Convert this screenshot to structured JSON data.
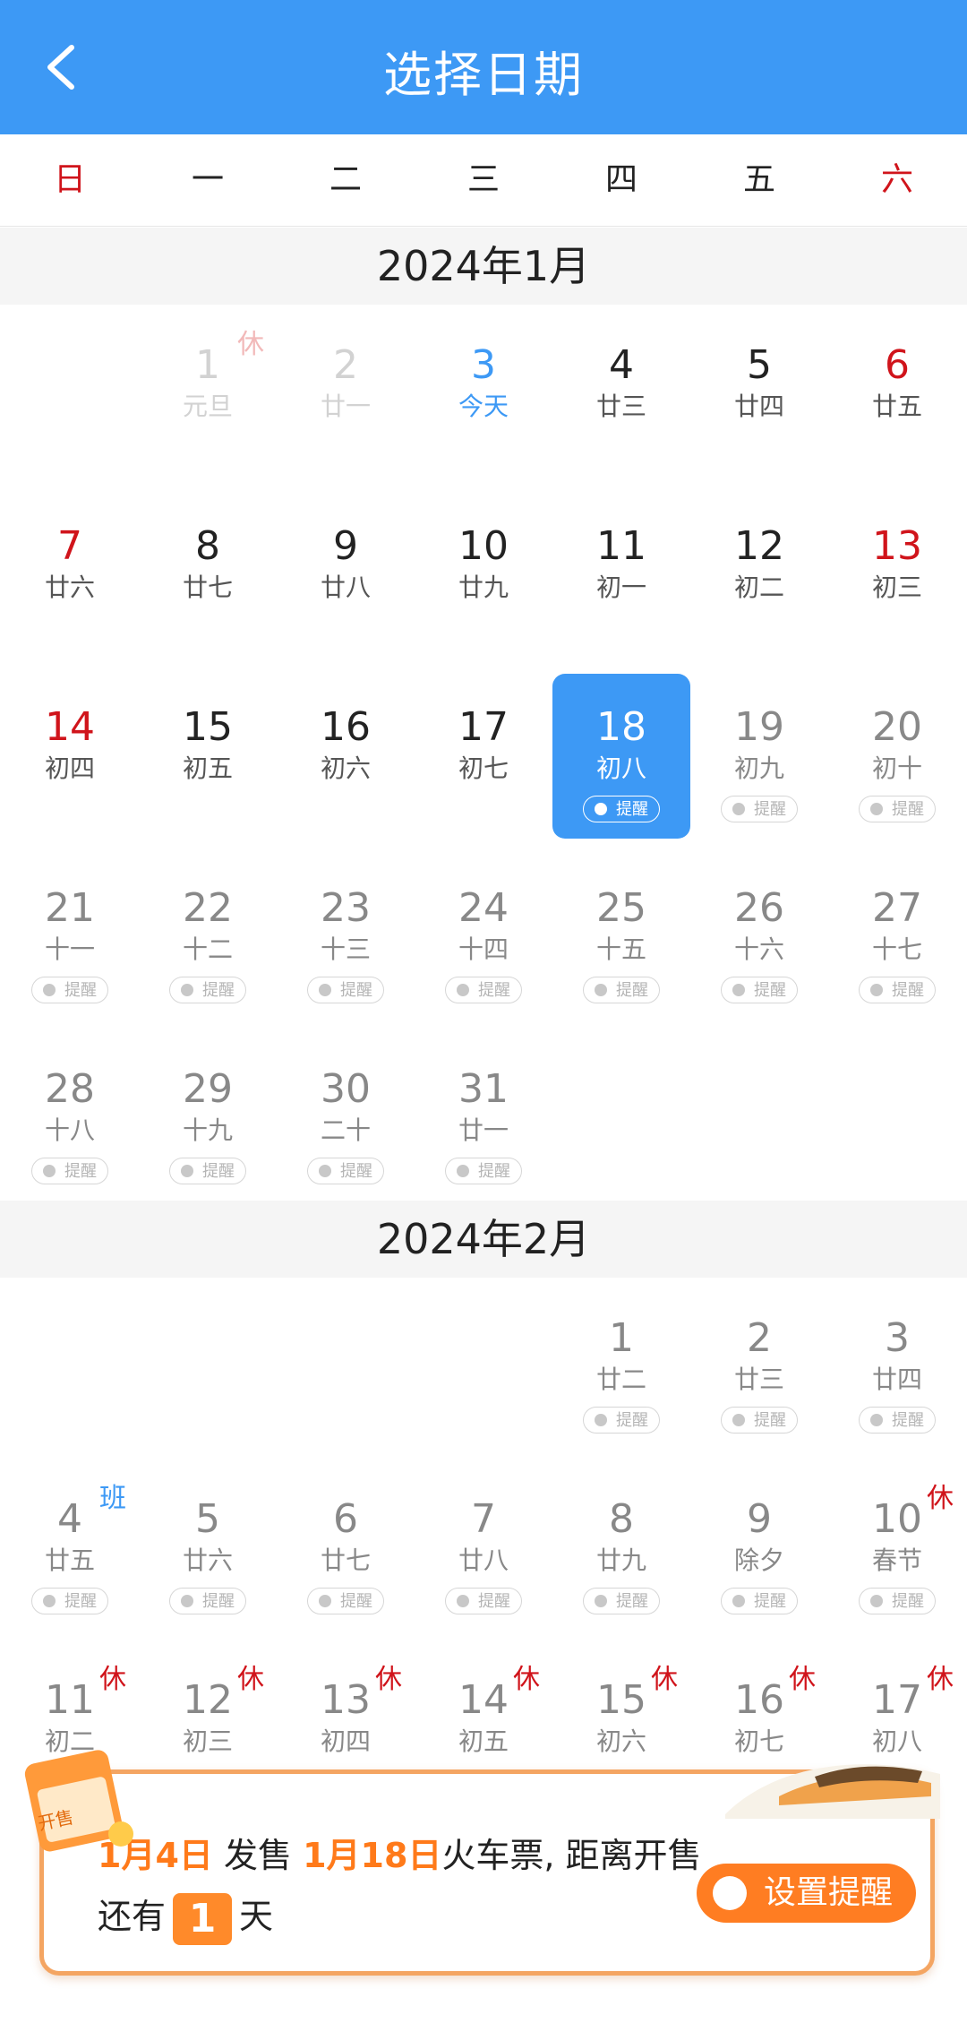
{
  "header": {
    "title": "选择日期"
  },
  "weekdays": [
    "日",
    "一",
    "二",
    "三",
    "四",
    "五",
    "六"
  ],
  "months": [
    {
      "label": "2024年1月",
      "rows": [
        [
          null,
          {
            "d": "1",
            "l": "元旦",
            "tag": "休",
            "state": "past"
          },
          {
            "d": "2",
            "l": "廿一",
            "state": "past"
          },
          {
            "d": "3",
            "l": "今天",
            "state": "today"
          },
          {
            "d": "4",
            "l": "廿三"
          },
          {
            "d": "5",
            "l": "廿四"
          },
          {
            "d": "6",
            "l": "廿五",
            "weekend": true
          }
        ],
        [
          {
            "d": "7",
            "l": "廿六",
            "weekend": true
          },
          {
            "d": "8",
            "l": "廿七"
          },
          {
            "d": "9",
            "l": "廿八"
          },
          {
            "d": "10",
            "l": "廿九"
          },
          {
            "d": "11",
            "l": "初一"
          },
          {
            "d": "12",
            "l": "初二"
          },
          {
            "d": "13",
            "l": "初三",
            "weekend": true
          }
        ],
        [
          {
            "d": "14",
            "l": "初四",
            "weekend": true
          },
          {
            "d": "15",
            "l": "初五"
          },
          {
            "d": "16",
            "l": "初六"
          },
          {
            "d": "17",
            "l": "初七"
          },
          {
            "d": "18",
            "l": "初八",
            "state": "selected",
            "remind": "提醒"
          },
          {
            "d": "19",
            "l": "初九",
            "state": "future",
            "remind": "提醒"
          },
          {
            "d": "20",
            "l": "初十",
            "state": "future",
            "remind": "提醒"
          }
        ],
        [
          {
            "d": "21",
            "l": "十一",
            "state": "future",
            "remind": "提醒"
          },
          {
            "d": "22",
            "l": "十二",
            "state": "future",
            "remind": "提醒"
          },
          {
            "d": "23",
            "l": "十三",
            "state": "future",
            "remind": "提醒"
          },
          {
            "d": "24",
            "l": "十四",
            "state": "future",
            "remind": "提醒"
          },
          {
            "d": "25",
            "l": "十五",
            "state": "future",
            "remind": "提醒"
          },
          {
            "d": "26",
            "l": "十六",
            "state": "future",
            "remind": "提醒"
          },
          {
            "d": "27",
            "l": "十七",
            "state": "future",
            "remind": "提醒"
          }
        ],
        [
          {
            "d": "28",
            "l": "十八",
            "state": "future",
            "remind": "提醒"
          },
          {
            "d": "29",
            "l": "十九",
            "state": "future",
            "remind": "提醒"
          },
          {
            "d": "30",
            "l": "二十",
            "state": "future",
            "remind": "提醒"
          },
          {
            "d": "31",
            "l": "廿一",
            "state": "future",
            "remind": "提醒"
          },
          null,
          null,
          null
        ]
      ]
    },
    {
      "label": "2024年2月",
      "rows": [
        [
          null,
          null,
          null,
          null,
          {
            "d": "1",
            "l": "廿二",
            "state": "future",
            "remind": "提醒"
          },
          {
            "d": "2",
            "l": "廿三",
            "state": "future",
            "remind": "提醒"
          },
          {
            "d": "3",
            "l": "廿四",
            "state": "future",
            "remind": "提醒"
          }
        ],
        [
          {
            "d": "4",
            "l": "廿五",
            "tag": "班",
            "state": "future",
            "remind": "提醒"
          },
          {
            "d": "5",
            "l": "廿六",
            "state": "future",
            "remind": "提醒"
          },
          {
            "d": "6",
            "l": "廿七",
            "state": "future",
            "remind": "提醒"
          },
          {
            "d": "7",
            "l": "廿八",
            "state": "future",
            "remind": "提醒"
          },
          {
            "d": "8",
            "l": "廿九",
            "state": "future",
            "remind": "提醒"
          },
          {
            "d": "9",
            "l": "除夕",
            "state": "future",
            "remind": "提醒"
          },
          {
            "d": "10",
            "l": "春节",
            "tag": "休",
            "state": "future",
            "remind": "提醒"
          }
        ],
        [
          {
            "d": "11",
            "l": "初二",
            "tag": "休",
            "state": "future"
          },
          {
            "d": "12",
            "l": "初三",
            "tag": "休",
            "state": "future"
          },
          {
            "d": "13",
            "l": "初四",
            "tag": "休",
            "state": "future"
          },
          {
            "d": "14",
            "l": "初五",
            "tag": "休",
            "state": "future"
          },
          {
            "d": "15",
            "l": "初六",
            "tag": "休",
            "state": "future"
          },
          {
            "d": "16",
            "l": "初七",
            "tag": "休",
            "state": "future"
          },
          {
            "d": "17",
            "l": "初八",
            "tag": "休",
            "state": "future"
          }
        ]
      ]
    }
  ],
  "banner": {
    "date1": "1月4日",
    "text1": " 发售 ",
    "date2": "1月18日",
    "text2": "火车票, 距离开售",
    "text3": "还有",
    "count": "1",
    "text4": "天",
    "button": "设置提醒",
    "badge": "开售"
  },
  "icons": {
    "back": "back-arrow-icon",
    "remind": "alarm-clock-icon"
  },
  "colors": {
    "primary": "#3d99f5",
    "holiday": "#d0141b",
    "accent": "#ff7d22"
  }
}
